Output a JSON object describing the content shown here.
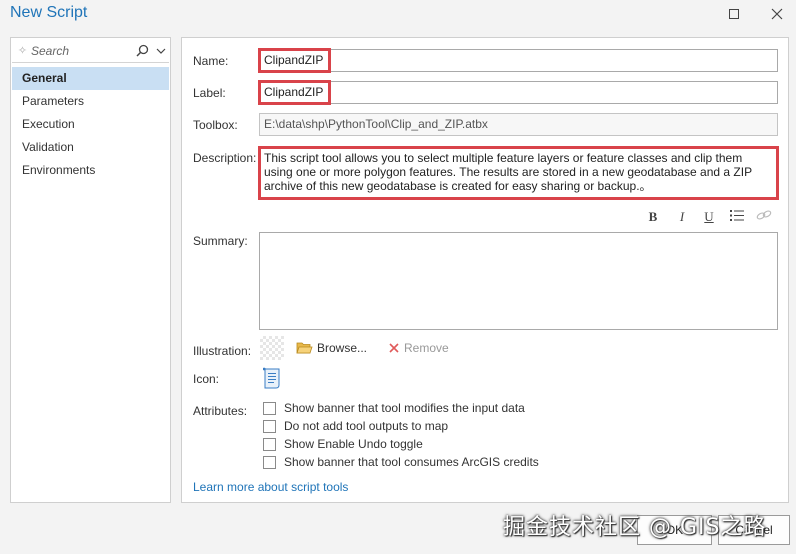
{
  "window": {
    "title": "New Script"
  },
  "sidebar": {
    "search_placeholder": "Search",
    "items": [
      {
        "label": "General",
        "active": true
      },
      {
        "label": "Parameters"
      },
      {
        "label": "Execution"
      },
      {
        "label": "Validation"
      },
      {
        "label": "Environments"
      }
    ]
  },
  "general": {
    "name_label": "Name:",
    "name_value": "ClipandZIP",
    "label_label": "Label:",
    "label_value": "ClipandZIP",
    "toolbox_label": "Toolbox:",
    "toolbox_value": "E:\\data\\shp\\PythonTool\\Clip_and_ZIP.atbx",
    "description_label": "Description:",
    "description_value": "This script tool allows you to select multiple feature layers or feature classes and clip them using one or more polygon features. The results are stored in a new geodatabase and a ZIP archive of this new geodatabase is created for easy sharing or backup.。",
    "format_buttons": [
      "B",
      "I",
      "U"
    ],
    "summary_label": "Summary:",
    "illustration_label": "Illustration:",
    "browse_label": "Browse...",
    "remove_label": "Remove",
    "icon_label": "Icon:",
    "attributes_label": "Attributes:",
    "attributes": [
      "Show banner that tool modifies the input data",
      "Do not add tool outputs to map",
      "Show Enable Undo toggle",
      "Show banner that tool consumes ArcGIS credits"
    ],
    "learn_more_link": "Learn more about script tools"
  },
  "footer": {
    "ok_label": "OK",
    "cancel_label": "Cancel"
  },
  "watermark": "掘金技术社区 @ GIS之路",
  "colors": {
    "accent": "#1f74b8",
    "highlight": "#d9434a",
    "active_nav": "#c9dff3"
  }
}
